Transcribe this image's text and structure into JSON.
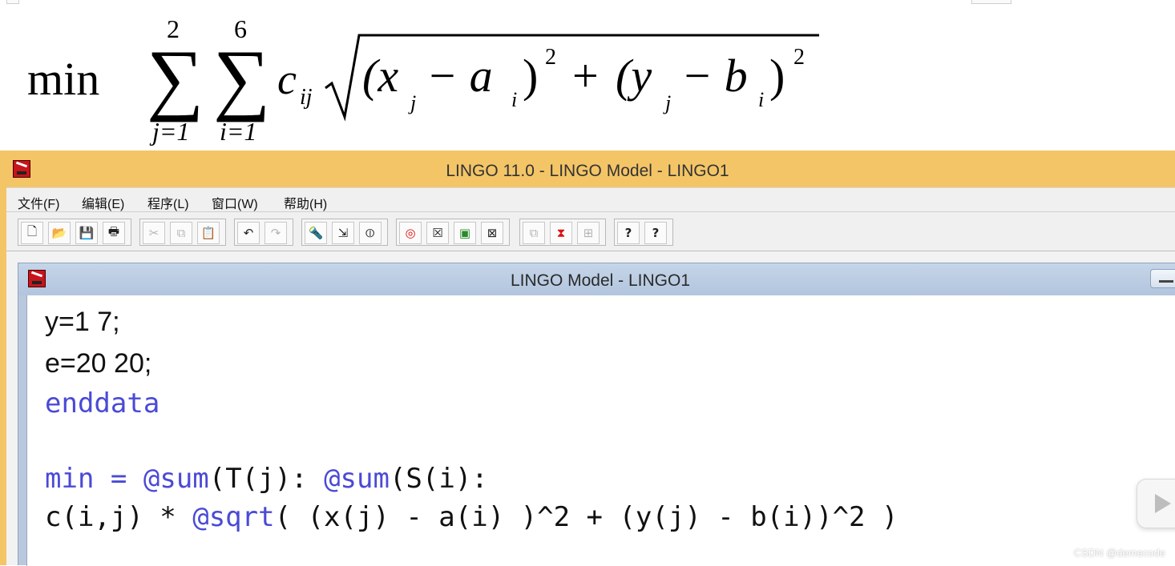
{
  "formula": {
    "min_label": "min",
    "sum1_upper": "2",
    "sum1_lower": "j=1",
    "sum2_upper": "6",
    "sum2_lower": "i=1",
    "coef": "c",
    "coef_sub": "ij",
    "term1_open": "(x",
    "term1_sub": "j",
    "term1_minus": " − a",
    "term1_sub2": "i",
    "term1_close": ")",
    "exp": "2",
    "plus": "+",
    "term2_open": "(y",
    "term2_sub": "j",
    "term2_minus": " − b",
    "term2_sub2": "i",
    "term2_close": ")"
  },
  "app": {
    "title": "LINGO 11.0 - LINGO Model - LINGO1",
    "menu": [
      "文件(F)",
      "编辑(E)",
      "程序(L)",
      "窗口(W)",
      "帮助(H)"
    ],
    "toolbar_icons": [
      "new-file-icon",
      "open-folder-icon",
      "save-icon",
      "print-icon",
      "cut-icon",
      "copy-icon",
      "paste-icon",
      "undo-icon",
      "redo-icon",
      "find-icon",
      "goto-line-icon",
      "match-paren-icon",
      "solve-icon",
      "solution-icon",
      "picture-icon",
      "close-all-icon",
      "send-to-back-icon",
      "tile-icon",
      "arrange-icon",
      "help-icon",
      "context-help-icon"
    ],
    "toolbar_glyphs": [
      "🗋",
      "📂",
      "💾",
      "🖶",
      "✂",
      "⧉",
      "📋",
      "↶",
      "↷",
      "🔦",
      "⇲",
      "⦶",
      "◎",
      "☒",
      "▣",
      "⊠",
      "⧉",
      "⧗",
      "⊞",
      "?",
      "?"
    ],
    "accent_color": "#f4c567"
  },
  "model_window": {
    "title": "LINGO Model - LINGO1",
    "code_lines": [
      {
        "text": "y=1 7;"
      },
      {
        "text": "e=20 20;"
      },
      {
        "text": "enddata"
      },
      {
        "text": ""
      },
      {
        "parts": [
          {
            "t": "min",
            "kw": true
          },
          {
            "t": " ",
            "kw": false
          },
          {
            "t": "=",
            "kw": true
          },
          {
            "t": " ",
            "kw": false
          },
          {
            "t": "@sum",
            "kw": true
          },
          {
            "t": "(T(j): ",
            "kw": false
          },
          {
            "t": "@sum",
            "kw": true
          },
          {
            "t": "(S(i):",
            "kw": false
          }
        ]
      },
      {
        "parts": [
          {
            "t": "c(i,j) * ",
            "kw": false
          },
          {
            "t": "@sqrt",
            "kw": true
          },
          {
            "t": "( (x(j) - a(i) )^2 + (y(j) - b(i))^2 )",
            "kw": false
          }
        ]
      }
    ],
    "keyword_color": "#4a4ad6"
  },
  "watermark": "CSDN @demecode"
}
